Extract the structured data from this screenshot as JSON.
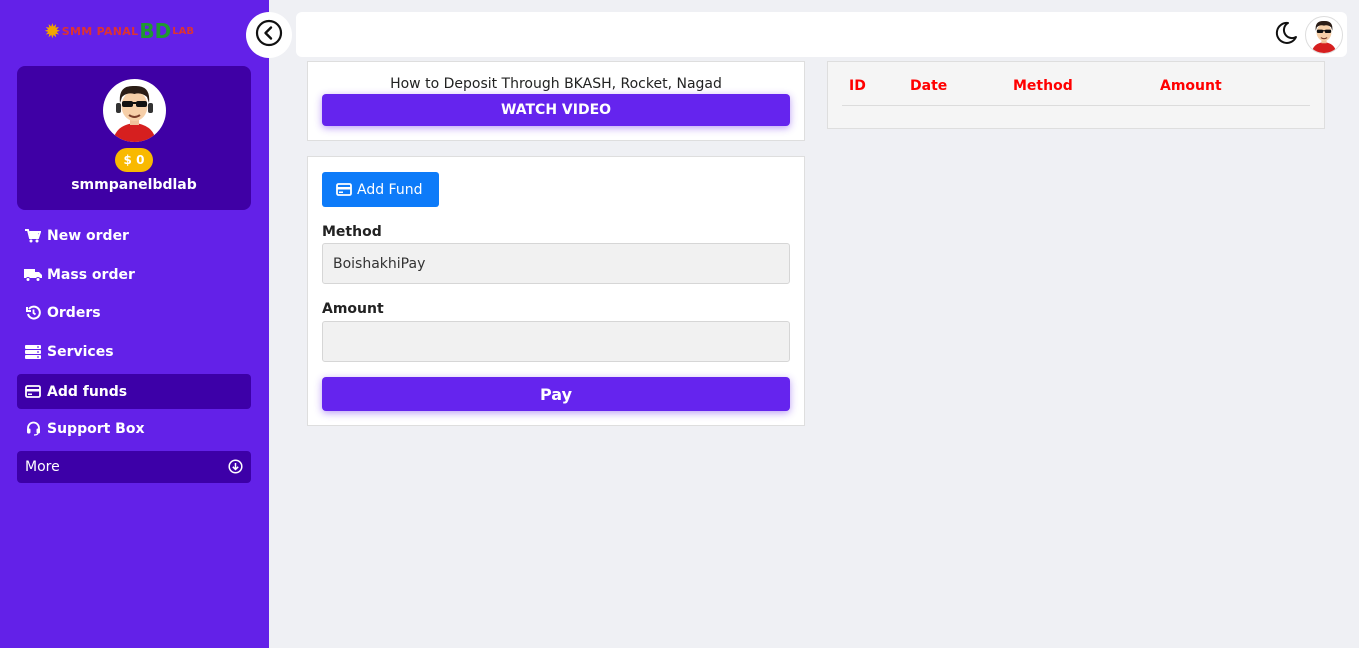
{
  "brand": {
    "logo_part1": "SMM PANAL",
    "logo_part2": "BD",
    "logo_part3": "LAB"
  },
  "profile": {
    "balance": "$ 0",
    "username": "smmpanelbdlab"
  },
  "menu": {
    "items": [
      {
        "label": "New order",
        "icon": "cart-icon"
      },
      {
        "label": "Mass order",
        "icon": "truck-icon"
      },
      {
        "label": "Orders",
        "icon": "history-icon"
      },
      {
        "label": "Services",
        "icon": "server-icon"
      },
      {
        "label": "Add funds",
        "icon": "credit-card-icon",
        "active": true
      },
      {
        "label": "Support Box",
        "icon": "headset-icon"
      }
    ],
    "more_label": "More"
  },
  "deposit": {
    "title": "How to Deposit Through BKASH, Rocket, Nagad",
    "watch_button": "WATCH VIDEO"
  },
  "form": {
    "add_fund_label": "Add Fund",
    "method_label": "Method",
    "method_value": "BoishakhiPay",
    "amount_label": "Amount",
    "amount_value": "",
    "pay_label": "Pay"
  },
  "history_table": {
    "columns": [
      "ID",
      "Date",
      "Method",
      "Amount"
    ],
    "rows": []
  },
  "colors": {
    "sidebar": "#6321e8",
    "active_item": "#3d00a8",
    "primary_button": "#6524ee",
    "add_fund_button": "#0d7bf9",
    "table_header": "#ff0000",
    "balance_badge": "#f9b900"
  }
}
